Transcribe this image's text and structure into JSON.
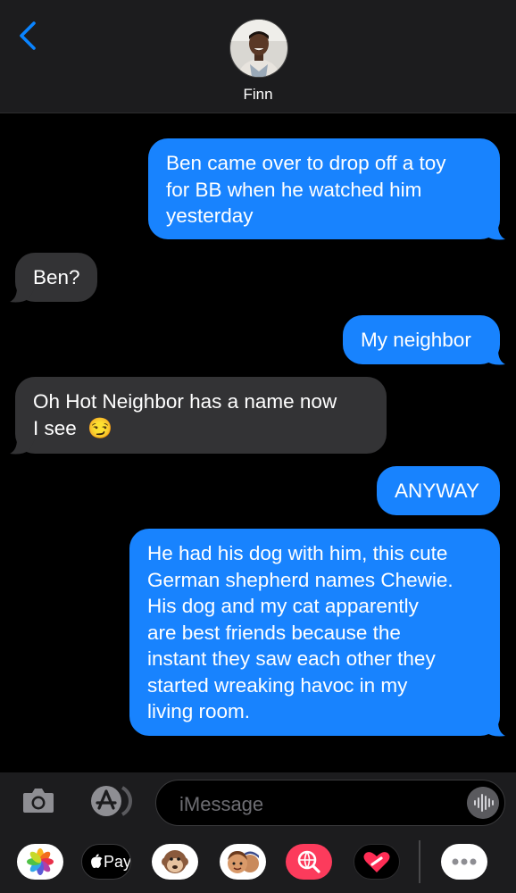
{
  "header": {
    "contact_name": "Finn"
  },
  "messages": [
    {
      "direction": "outgoing",
      "lines": [
        "Ben came over to drop off a toy",
        "for BB when he watched him",
        "yesterday"
      ]
    },
    {
      "direction": "incoming",
      "lines": [
        "Ben?"
      ]
    },
    {
      "direction": "outgoing",
      "lines": [
        "My neighbor"
      ]
    },
    {
      "direction": "incoming",
      "lines": [
        "Oh Hot Neighbor has a name now",
        "I see"
      ],
      "emoji": "😏"
    },
    {
      "direction": "outgoing",
      "lines": [
        "ANYWAY"
      ]
    },
    {
      "direction": "outgoing",
      "lines": [
        "He had his dog with him, this cute",
        "German shepherd names Chewie.",
        "His dog and my cat apparently",
        "are best friends because the",
        "instant they saw each other they",
        "started wreaking havoc in my",
        "living room."
      ]
    }
  ],
  "composer": {
    "placeholder": "iMessage"
  },
  "app_drawer": {
    "apple_pay_label": "Pay",
    "icons": [
      "photos-icon",
      "apple-pay-icon",
      "animoji-icon",
      "memoji-icon",
      "web-search-icon",
      "digital-touch-icon",
      "more-icon"
    ]
  },
  "colors": {
    "outgoing_bubble": "#1883fe",
    "incoming_bubble": "#333335",
    "accent": "#0a84ff",
    "background": "#000000",
    "bar": "#1c1c1e"
  }
}
